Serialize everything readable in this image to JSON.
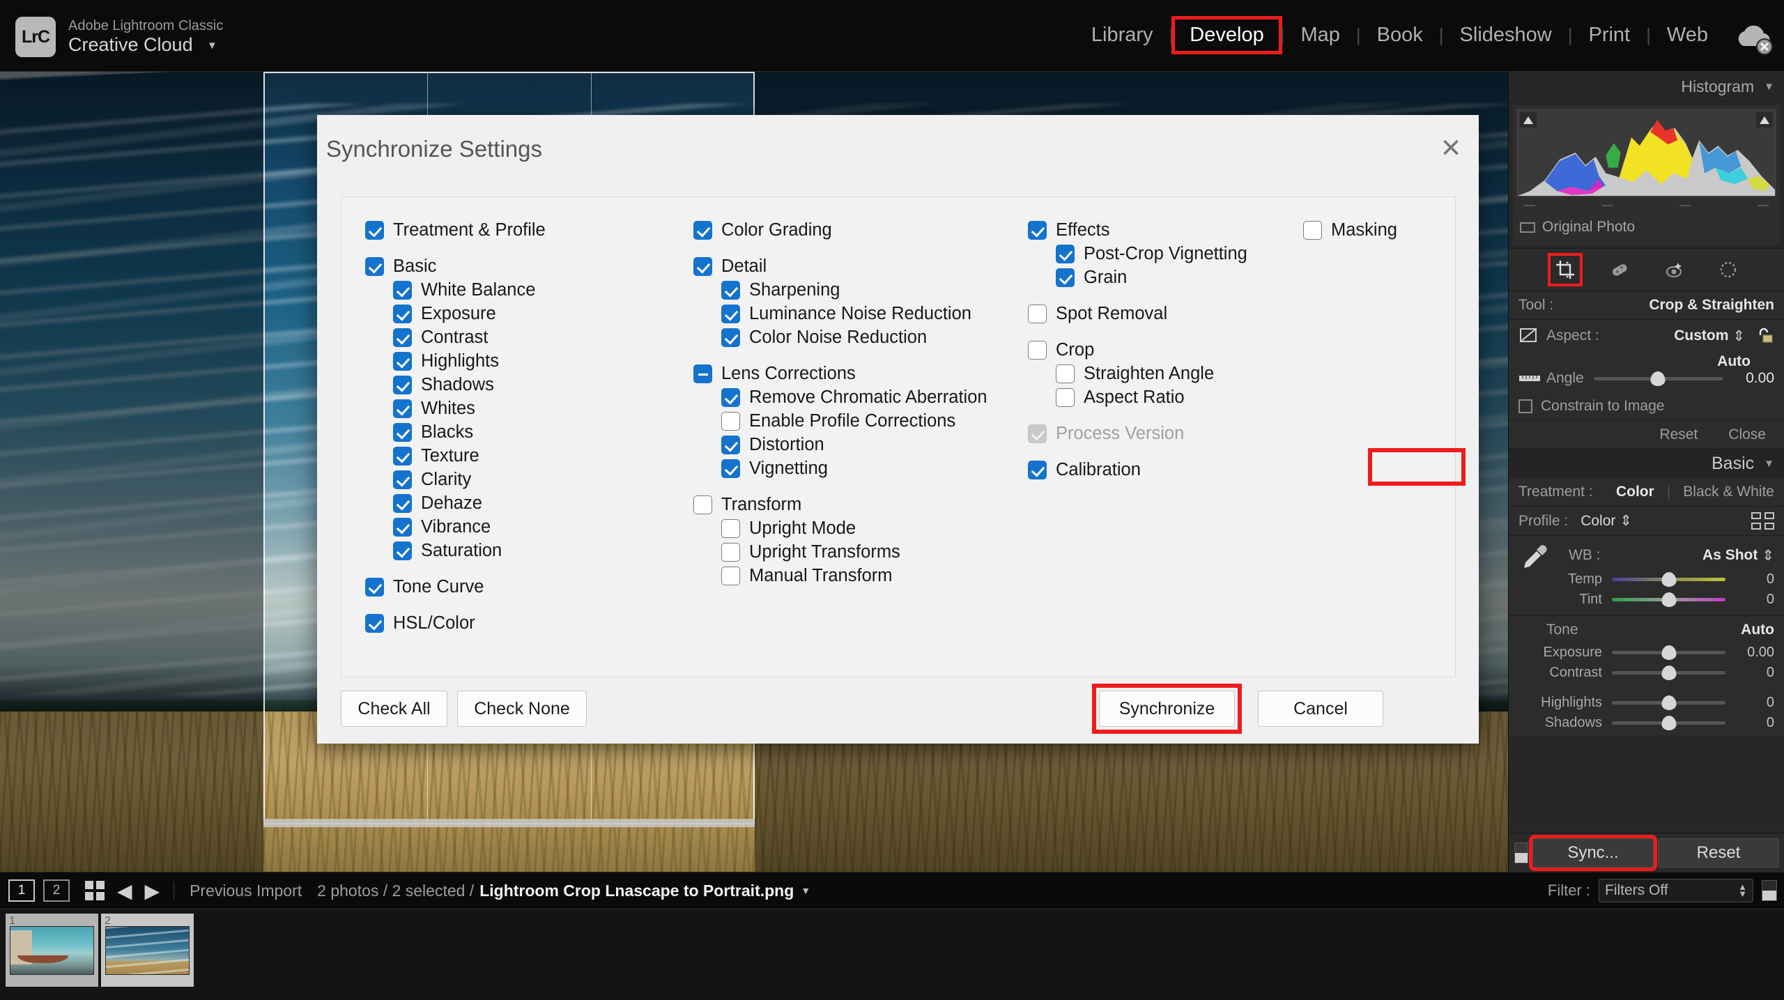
{
  "app": {
    "logo_text": "LrC",
    "product_sub": "Adobe Lightroom Classic",
    "product_main": "Creative Cloud",
    "caret": "▼"
  },
  "modules": [
    {
      "label": "Library",
      "active": false
    },
    {
      "label": "Develop",
      "active": true
    },
    {
      "label": "Map",
      "active": false
    },
    {
      "label": "Book",
      "active": false
    },
    {
      "label": "Slideshow",
      "active": false
    },
    {
      "label": "Print",
      "active": false
    },
    {
      "label": "Web",
      "active": false
    }
  ],
  "module_separator": "|",
  "dialog": {
    "title": "Synchronize Settings",
    "close_label": "✕",
    "columns": [
      {
        "items": [
          {
            "label": "Treatment & Profile",
            "state": "checked",
            "indent": 0,
            "gap_before": false
          },
          {
            "label": "Basic",
            "state": "checked",
            "indent": 0,
            "gap_before": true
          },
          {
            "label": "White Balance",
            "state": "checked",
            "indent": 1,
            "gap_before": false
          },
          {
            "label": "Exposure",
            "state": "checked",
            "indent": 1,
            "gap_before": false
          },
          {
            "label": "Contrast",
            "state": "checked",
            "indent": 1,
            "gap_before": false
          },
          {
            "label": "Highlights",
            "state": "checked",
            "indent": 1,
            "gap_before": false
          },
          {
            "label": "Shadows",
            "state": "checked",
            "indent": 1,
            "gap_before": false
          },
          {
            "label": "Whites",
            "state": "checked",
            "indent": 1,
            "gap_before": false
          },
          {
            "label": "Blacks",
            "state": "checked",
            "indent": 1,
            "gap_before": false
          },
          {
            "label": "Texture",
            "state": "checked",
            "indent": 1,
            "gap_before": false
          },
          {
            "label": "Clarity",
            "state": "checked",
            "indent": 1,
            "gap_before": false
          },
          {
            "label": "Dehaze",
            "state": "checked",
            "indent": 1,
            "gap_before": false
          },
          {
            "label": "Vibrance",
            "state": "checked",
            "indent": 1,
            "gap_before": false
          },
          {
            "label": "Saturation",
            "state": "checked",
            "indent": 1,
            "gap_before": false
          },
          {
            "label": "Tone Curve",
            "state": "checked",
            "indent": 0,
            "gap_before": true
          },
          {
            "label": "HSL/Color",
            "state": "checked",
            "indent": 0,
            "gap_before": true
          }
        ]
      },
      {
        "items": [
          {
            "label": "Color Grading",
            "state": "checked",
            "indent": 0,
            "gap_before": false
          },
          {
            "label": "Detail",
            "state": "checked",
            "indent": 0,
            "gap_before": true
          },
          {
            "label": "Sharpening",
            "state": "checked",
            "indent": 1,
            "gap_before": false
          },
          {
            "label": "Luminance Noise Reduction",
            "state": "checked",
            "indent": 1,
            "gap_before": false
          },
          {
            "label": "Color Noise Reduction",
            "state": "checked",
            "indent": 1,
            "gap_before": false
          },
          {
            "label": "Lens Corrections",
            "state": "mixed",
            "indent": 0,
            "gap_before": true
          },
          {
            "label": "Remove Chromatic Aberration",
            "state": "checked",
            "indent": 1,
            "gap_before": false
          },
          {
            "label": "Enable Profile Corrections",
            "state": "unchecked",
            "indent": 1,
            "gap_before": false
          },
          {
            "label": "Distortion",
            "state": "checked",
            "indent": 1,
            "gap_before": false
          },
          {
            "label": "Vignetting",
            "state": "checked",
            "indent": 1,
            "gap_before": false
          },
          {
            "label": "Transform",
            "state": "unchecked",
            "indent": 0,
            "gap_before": true
          },
          {
            "label": "Upright Mode",
            "state": "unchecked",
            "indent": 1,
            "gap_before": false
          },
          {
            "label": "Upright Transforms",
            "state": "unchecked",
            "indent": 1,
            "gap_before": false
          },
          {
            "label": "Manual Transform",
            "state": "unchecked",
            "indent": 1,
            "gap_before": false
          }
        ]
      },
      {
        "items": [
          {
            "label": "Effects",
            "state": "checked",
            "indent": 0,
            "gap_before": false
          },
          {
            "label": "Post-Crop Vignetting",
            "state": "checked",
            "indent": 1,
            "gap_before": false
          },
          {
            "label": "Grain",
            "state": "checked",
            "indent": 1,
            "gap_before": false
          },
          {
            "label": "Spot Removal",
            "state": "unchecked",
            "indent": 0,
            "gap_before": true
          },
          {
            "label": "Crop",
            "state": "unchecked",
            "indent": 0,
            "gap_before": true
          },
          {
            "label": "Straighten Angle",
            "state": "unchecked",
            "indent": 1,
            "gap_before": false
          },
          {
            "label": "Aspect Ratio",
            "state": "unchecked",
            "indent": 1,
            "gap_before": false
          },
          {
            "label": "Process Version",
            "state": "disabled-checked",
            "indent": 0,
            "gap_before": true
          },
          {
            "label": "Calibration",
            "state": "checked",
            "indent": 0,
            "gap_before": true
          }
        ]
      },
      {
        "items": [
          {
            "label": "Masking",
            "state": "unchecked",
            "indent": 0,
            "gap_before": false
          }
        ]
      }
    ],
    "buttons": {
      "check_all": "Check All",
      "check_none": "Check None",
      "synchronize": "Synchronize",
      "cancel": "Cancel"
    }
  },
  "right_panel": {
    "histogram_title": "Histogram",
    "histogram_caret": "▼",
    "hist_ticks": [
      "—",
      "—",
      "—",
      "—"
    ],
    "original_photo": "Original Photo",
    "tool_label": "Tool :",
    "tool_value": "Crop & Straighten",
    "aspect_label": "Aspect :",
    "aspect_value": "Custom",
    "aspect_stepper": "⇕",
    "auto_label": "Auto",
    "angle_label": "Angle",
    "angle_value": "0.00",
    "constrain_label": "Constrain to Image",
    "reset_label": "Reset",
    "close_label": "Close",
    "basic_title": "Basic",
    "basic_caret": "▼",
    "treatment_label": "Treatment :",
    "treatment_color": "Color",
    "treatment_bw": "Black & White",
    "profile_label": "Profile :",
    "profile_value": "Color",
    "profile_stepper": "⇕",
    "wb_label": "WB :",
    "wb_value": "As Shot",
    "wb_stepper": "⇕",
    "temp_label": "Temp",
    "temp_value": "0",
    "tint_label": "Tint",
    "tint_value": "0",
    "tone_label": "Tone",
    "tone_auto": "Auto",
    "sliders": [
      {
        "name": "Exposure",
        "value": "0.00"
      },
      {
        "name": "Contrast",
        "value": "0"
      },
      {
        "name": "Highlights",
        "value": "0"
      },
      {
        "name": "Shadows",
        "value": "0"
      }
    ],
    "sync_button": "Sync...",
    "reset_button": "Reset"
  },
  "bottom_bar": {
    "view_1": "1",
    "view_2": "2",
    "prev_arrow": "◀",
    "next_arrow": "▶",
    "source": "Previous Import",
    "count": "2 photos / 2 selected /",
    "filename": "Lightroom Crop Lnascape to Portrait.png",
    "filename_caret": "▼",
    "filter_label": "Filter :",
    "filter_value": "Filters Off"
  },
  "filmstrip": {
    "thumbs": [
      {
        "num": "1",
        "active": true
      },
      {
        "num": "2",
        "active": false
      }
    ]
  },
  "colors": {
    "accent_blue": "#1473cd",
    "highlight_red": "#ef1c1c",
    "panel_bg": "#272727",
    "dialog_bg": "#f0f0f0"
  }
}
